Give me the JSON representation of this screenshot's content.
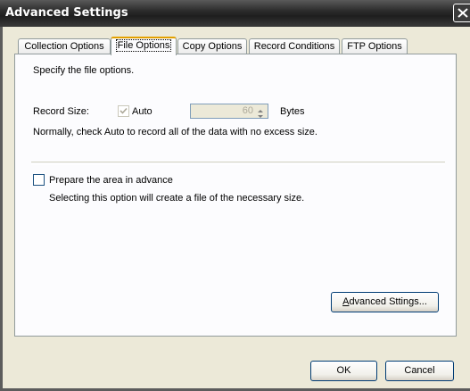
{
  "window": {
    "title": "Advanced Settings",
    "close_icon": "close-icon"
  },
  "tabs": [
    {
      "label": "Collection Options",
      "active": false
    },
    {
      "label": "File Options",
      "active": true
    },
    {
      "label": "Copy Options",
      "active": false
    },
    {
      "label": "Record Conditions",
      "active": false
    },
    {
      "label": "FTP Options",
      "active": false
    }
  ],
  "panel": {
    "intro": "Specify the file options.",
    "record_size_label": "Record Size:",
    "auto_label": "Auto",
    "auto_checked": true,
    "auto_disabled": true,
    "size_value": "60",
    "size_unit": "Bytes",
    "note": "Normally, check Auto to record all of the data with no excess size.",
    "prepare_label": "Prepare the area in advance",
    "prepare_checked": false,
    "prepare_description": "Selecting this option will create a file of the necessary size.",
    "advanced_button_underline": "A",
    "advanced_button_rest": "dvanced Sttings..."
  },
  "footer": {
    "ok_label": "OK",
    "cancel_label": "Cancel"
  },
  "colors": {
    "title_bar": "#2c2c2c",
    "dialog_bg": "#ece9d8",
    "panel_bg": "#fcfcfe",
    "active_tab_accent": "#e3a000"
  }
}
